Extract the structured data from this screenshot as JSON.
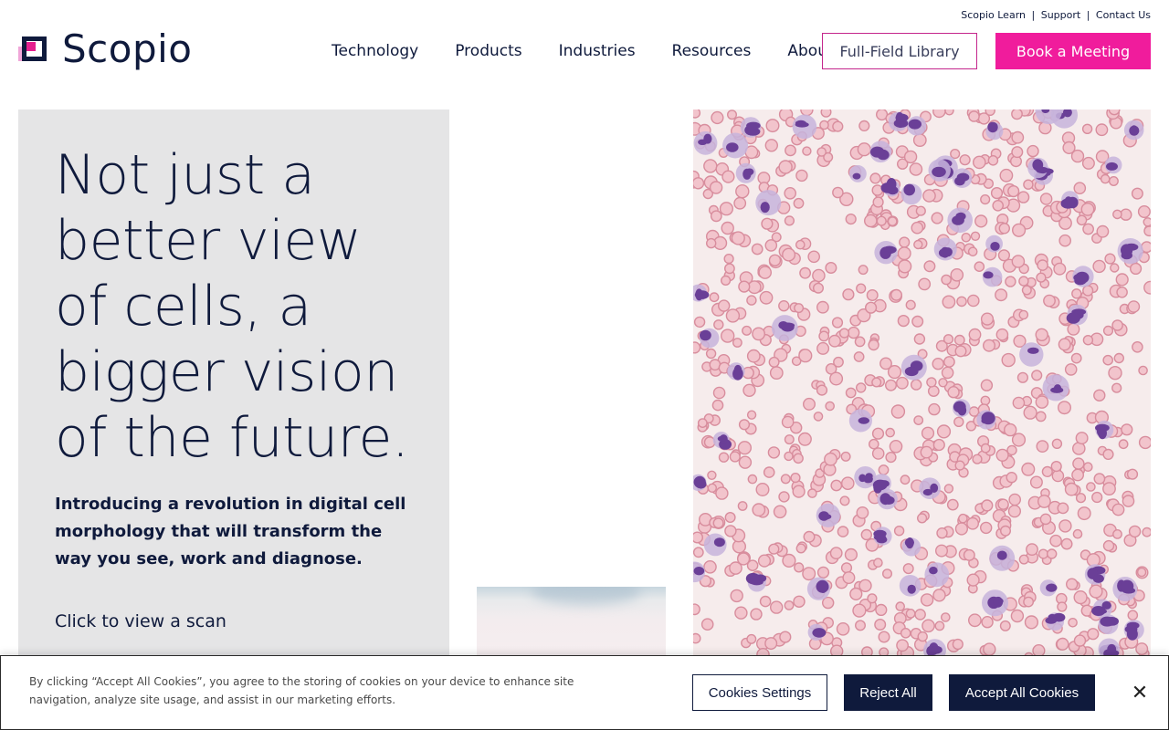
{
  "utility_links": {
    "learn": "Scopio Learn",
    "support": "Support",
    "contact": "Contact Us",
    "separator": "|"
  },
  "logo": {
    "text": "Scopio",
    "icon": "scopio-logo-icon"
  },
  "nav": {
    "items": [
      {
        "label": "Technology"
      },
      {
        "label": "Products"
      },
      {
        "label": "Industries"
      },
      {
        "label": "Resources"
      },
      {
        "label": "About"
      }
    ],
    "library_button": "Full-Field Library",
    "meeting_button": "Book a Meeting"
  },
  "hero": {
    "title": "Not just a better view of cells, a bigger vision of the future.",
    "subtitle": "Introducing a revolution in digital cell morphology that will transform the way you see, work and diagnose.",
    "link": "Click to view a scan"
  },
  "cookie_banner": {
    "text": "By clicking “Accept All Cookies”, you agree to the storing of cookies on your device to enhance site navigation, analyze site usage, and assist in our marketing efforts.",
    "settings_button": "Cookies Settings",
    "reject_button": "Reject All",
    "accept_button": "Accept All Cookies",
    "close_icon": "close-icon"
  },
  "colors": {
    "navy": "#0f1a3c",
    "magenta": "#f01c9c",
    "panel_gray": "#e5e5e6"
  }
}
